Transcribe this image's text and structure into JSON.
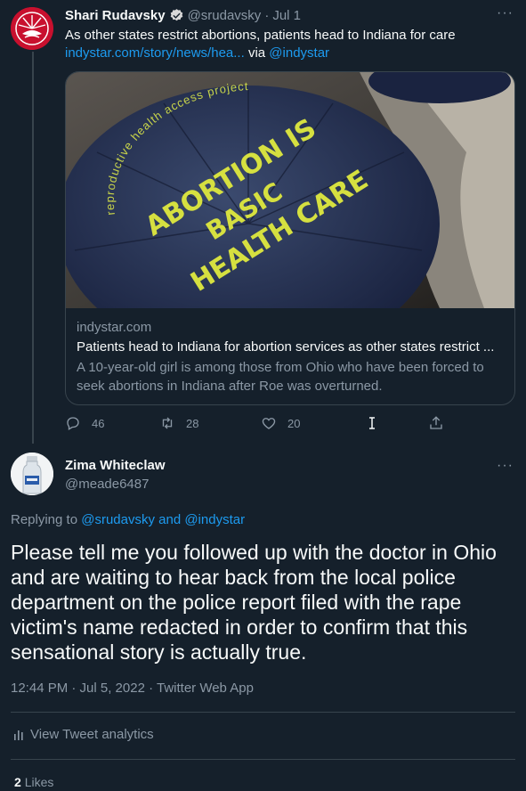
{
  "parent_tweet": {
    "author_name": "Shari Rudavsky",
    "handle": "@srudavsky",
    "separator": "·",
    "date": "Jul 1",
    "more_label": "···",
    "text": "As other states restrict abortions, patients head to Indiana for care",
    "link_text": "indystar.com/story/news/hea...",
    "via_text": "via",
    "via_handle": "@indystar",
    "card": {
      "image_button_ring_text": "reproductive health access project",
      "image_button_text_line1": "ABORTION IS",
      "image_button_text_line2": "BASIC",
      "image_button_text_line3": "HEALTH CARE",
      "domain": "indystar.com",
      "title": "Patients head to Indiana for abortion services as other states restrict ...",
      "description": "A 10-year-old girl is among those from Ohio who have been forced to seek abortions in Indiana after Roe was overturned."
    },
    "actions": {
      "replies": "46",
      "retweets": "28",
      "likes": "20"
    }
  },
  "main_tweet": {
    "author_name": "Zima Whiteclaw",
    "handle": "@meade6487",
    "more_label": "···",
    "replying_prefix": "Replying to",
    "replying_handles": "@srudavsky and @indystar",
    "text": "Please tell me you followed up with the doctor in Ohio and are waiting to hear back from the local police department on the police report filed with the rape victim's name redacted in order to confirm that this sensational story is actually true.",
    "meta": "12:44 PM · Jul 5, 2022 · Twitter Web App",
    "analytics_label": "View Tweet analytics",
    "likes_count": "2",
    "likes_label": "Likes"
  },
  "colors": {
    "background": "#15202b",
    "text_primary": "#f7f9f9",
    "text_secondary": "#8b98a5",
    "accent": "#1d9bf0",
    "border": "#38444d"
  }
}
